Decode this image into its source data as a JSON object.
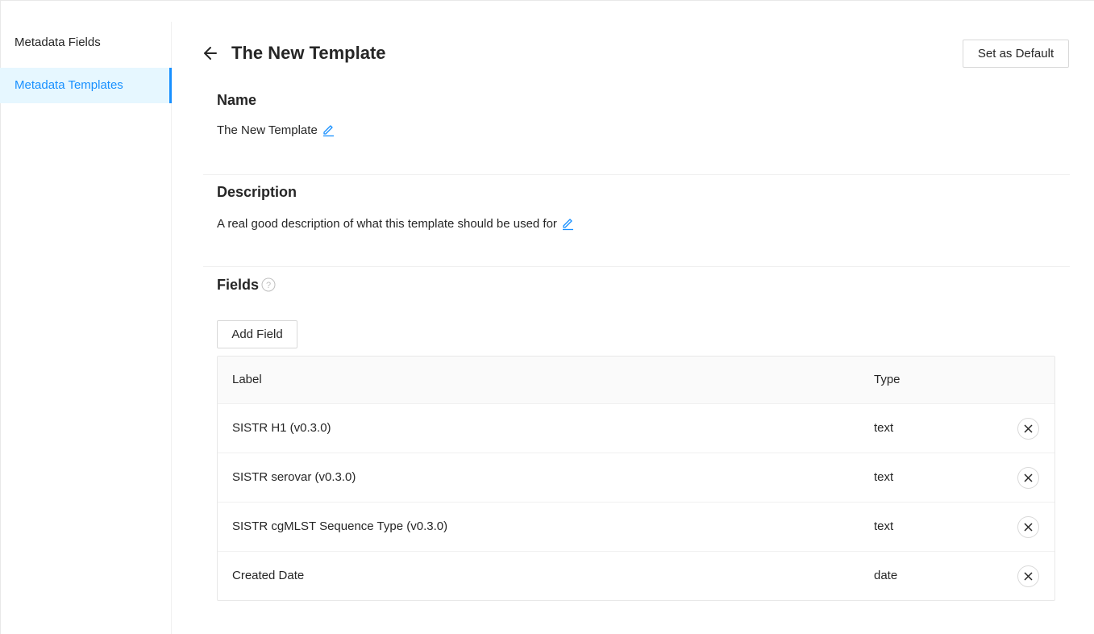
{
  "sidebar": {
    "items": [
      {
        "label": "Metadata Fields",
        "active": false
      },
      {
        "label": "Metadata Templates",
        "active": true
      }
    ]
  },
  "header": {
    "back_icon": "arrow-left-icon",
    "title": "The New Template",
    "default_button": "Set as Default"
  },
  "name_section": {
    "title": "Name",
    "value": "The New Template",
    "edit_icon": "pencil-icon"
  },
  "description_section": {
    "title": "Description",
    "value": "A real good description of what this template should be used for",
    "edit_icon": "pencil-icon"
  },
  "fields_section": {
    "title": "Fields",
    "help_icon": "question-circle-icon",
    "add_button": "Add Field",
    "table": {
      "columns": [
        "Label",
        "Type"
      ],
      "rows": [
        {
          "label": "SISTR H1 (v0.3.0)",
          "type": "text"
        },
        {
          "label": "SISTR serovar (v0.3.0)",
          "type": "text"
        },
        {
          "label": "SISTR cgMLST Sequence Type (v0.3.0)",
          "type": "text"
        },
        {
          "label": "Created Date",
          "type": "date"
        }
      ],
      "remove_icon": "close-icon"
    }
  },
  "colors": {
    "accent": "#1890ff",
    "active_bg": "#e6f7ff",
    "border": "#d9d9d9",
    "text": "#262626"
  }
}
